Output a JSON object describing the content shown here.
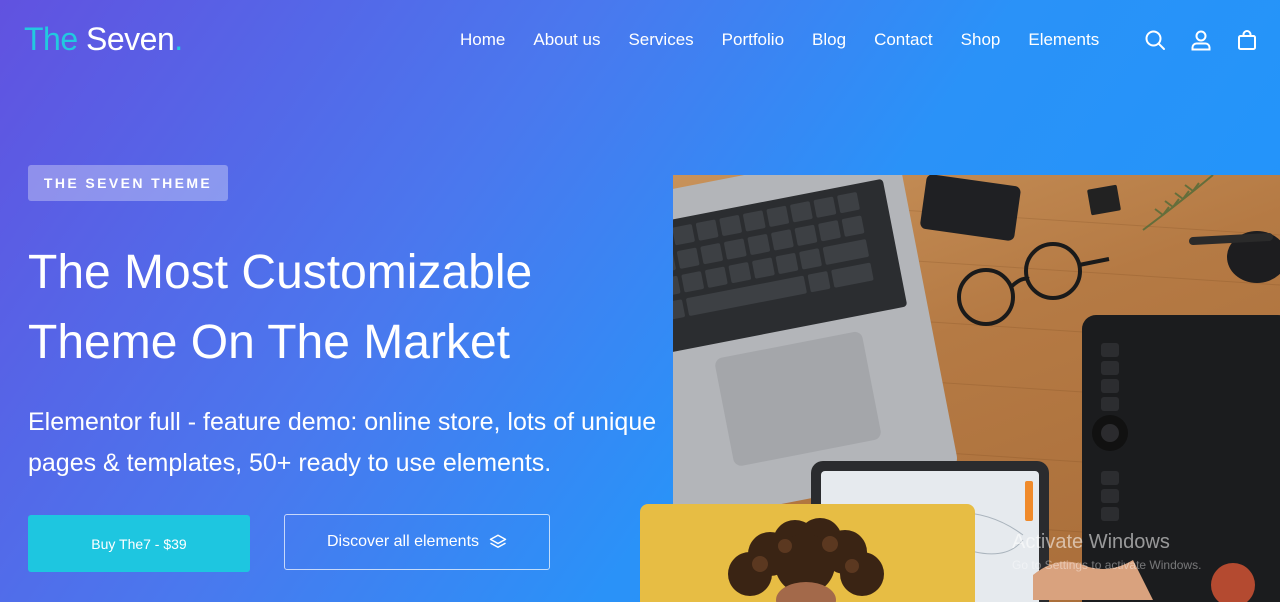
{
  "logo": {
    "the": "The",
    "seven": "Seven",
    "dot": "."
  },
  "nav": {
    "items": [
      "Home",
      "About us",
      "Services",
      "Portfolio",
      "Blog",
      "Contact",
      "Shop",
      "Elements"
    ]
  },
  "header_icons": [
    "search-icon",
    "user-icon",
    "shopping-bag-icon"
  ],
  "hero": {
    "badge": "THE SEVEN THEME",
    "headline_line1": "The Most Customizable",
    "headline_line2": "Theme On The Market",
    "subline_line1": "Elementor full - feature demo: online store, lots of unique",
    "subline_line2": "pages & templates, 50+ ready to use elements.",
    "buy_label": "Buy The7 - $39",
    "discover_label": "Discover all elements"
  },
  "overlay": {
    "watermark_title": "Activate Windows",
    "watermark_sub": "Go to Settings to activate Windows."
  },
  "colors": {
    "accent": "#1ec6e0",
    "gradient_start": "#6152e0",
    "gradient_end": "#1e96fb",
    "portrait_card": "#e7bd44"
  }
}
